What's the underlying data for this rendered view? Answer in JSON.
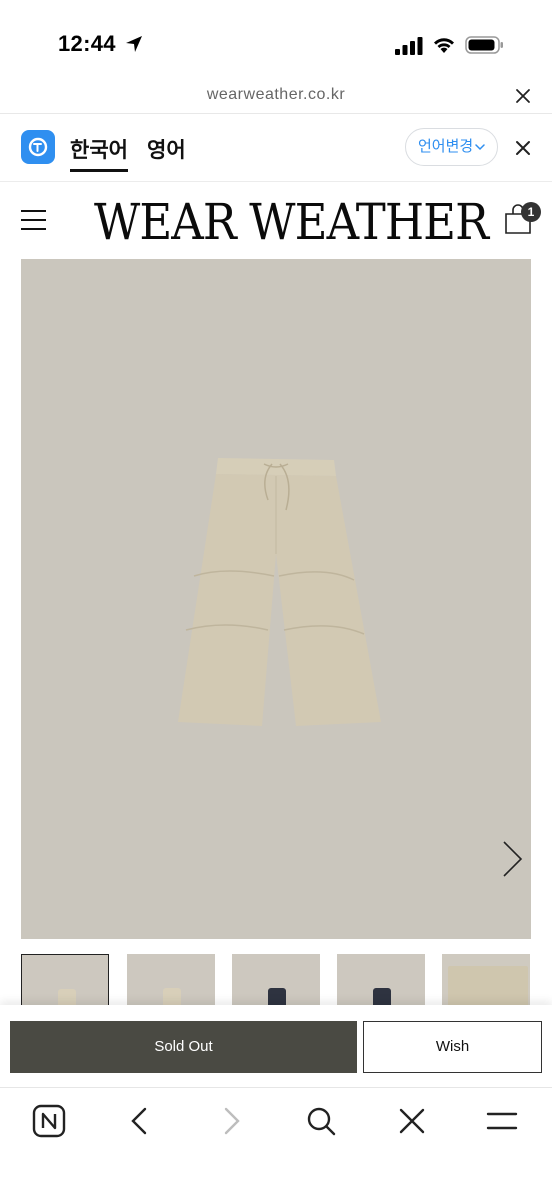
{
  "status_bar": {
    "time": "12:44"
  },
  "url_bar": {
    "domain": "wearweather.co.kr"
  },
  "translate_bar": {
    "tabs": [
      "한국어",
      "영어"
    ],
    "change_label": "언어변경"
  },
  "header": {
    "brand": "WEAR WEATHER",
    "cart_count": "1"
  },
  "product": {
    "image_background": "#cac6bd",
    "product_color": "#d2c9b3"
  },
  "thumbnails": [
    {
      "color": "#cfcac0",
      "item_color": "#d8cfb9",
      "selected": true
    },
    {
      "color": "#cfcac0",
      "item_color": "#d8cfb9",
      "selected": false
    },
    {
      "color": "#cfcac0",
      "item_color": "#2e3340",
      "selected": false
    },
    {
      "color": "#cfcac0",
      "item_color": "#2e3340",
      "selected": false
    },
    {
      "color": "#cfcac0",
      "item_color": "#cfc6ae",
      "selected": false
    }
  ],
  "actions": {
    "sold_out_label": "Sold Out",
    "wish_label": "Wish",
    "sold_out_color": "#4a4a43"
  },
  "toolbar": {
    "icons": [
      "naver-n-icon",
      "back-icon",
      "forward-icon",
      "search-icon",
      "close-icon",
      "menu-icon"
    ]
  }
}
